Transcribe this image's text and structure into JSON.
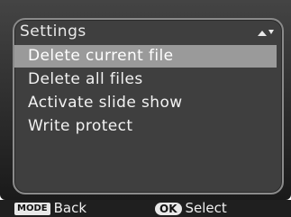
{
  "menu": {
    "title": "Settings",
    "items": [
      {
        "label": "Delete current file",
        "selected": true
      },
      {
        "label": "Delete all files",
        "selected": false
      },
      {
        "label": "Activate slide show",
        "selected": false
      },
      {
        "label": "Write protect",
        "selected": false
      }
    ]
  },
  "footer": {
    "back_key": "MODE",
    "back_label": "Back",
    "select_key": "OK",
    "select_label": "Select"
  },
  "colors": {
    "panel_background": "#3f3f3f",
    "highlight": "#9a9a9a",
    "text": "#f2f2f2"
  },
  "icons": {
    "scroll": "scroll-up-down-icon"
  }
}
